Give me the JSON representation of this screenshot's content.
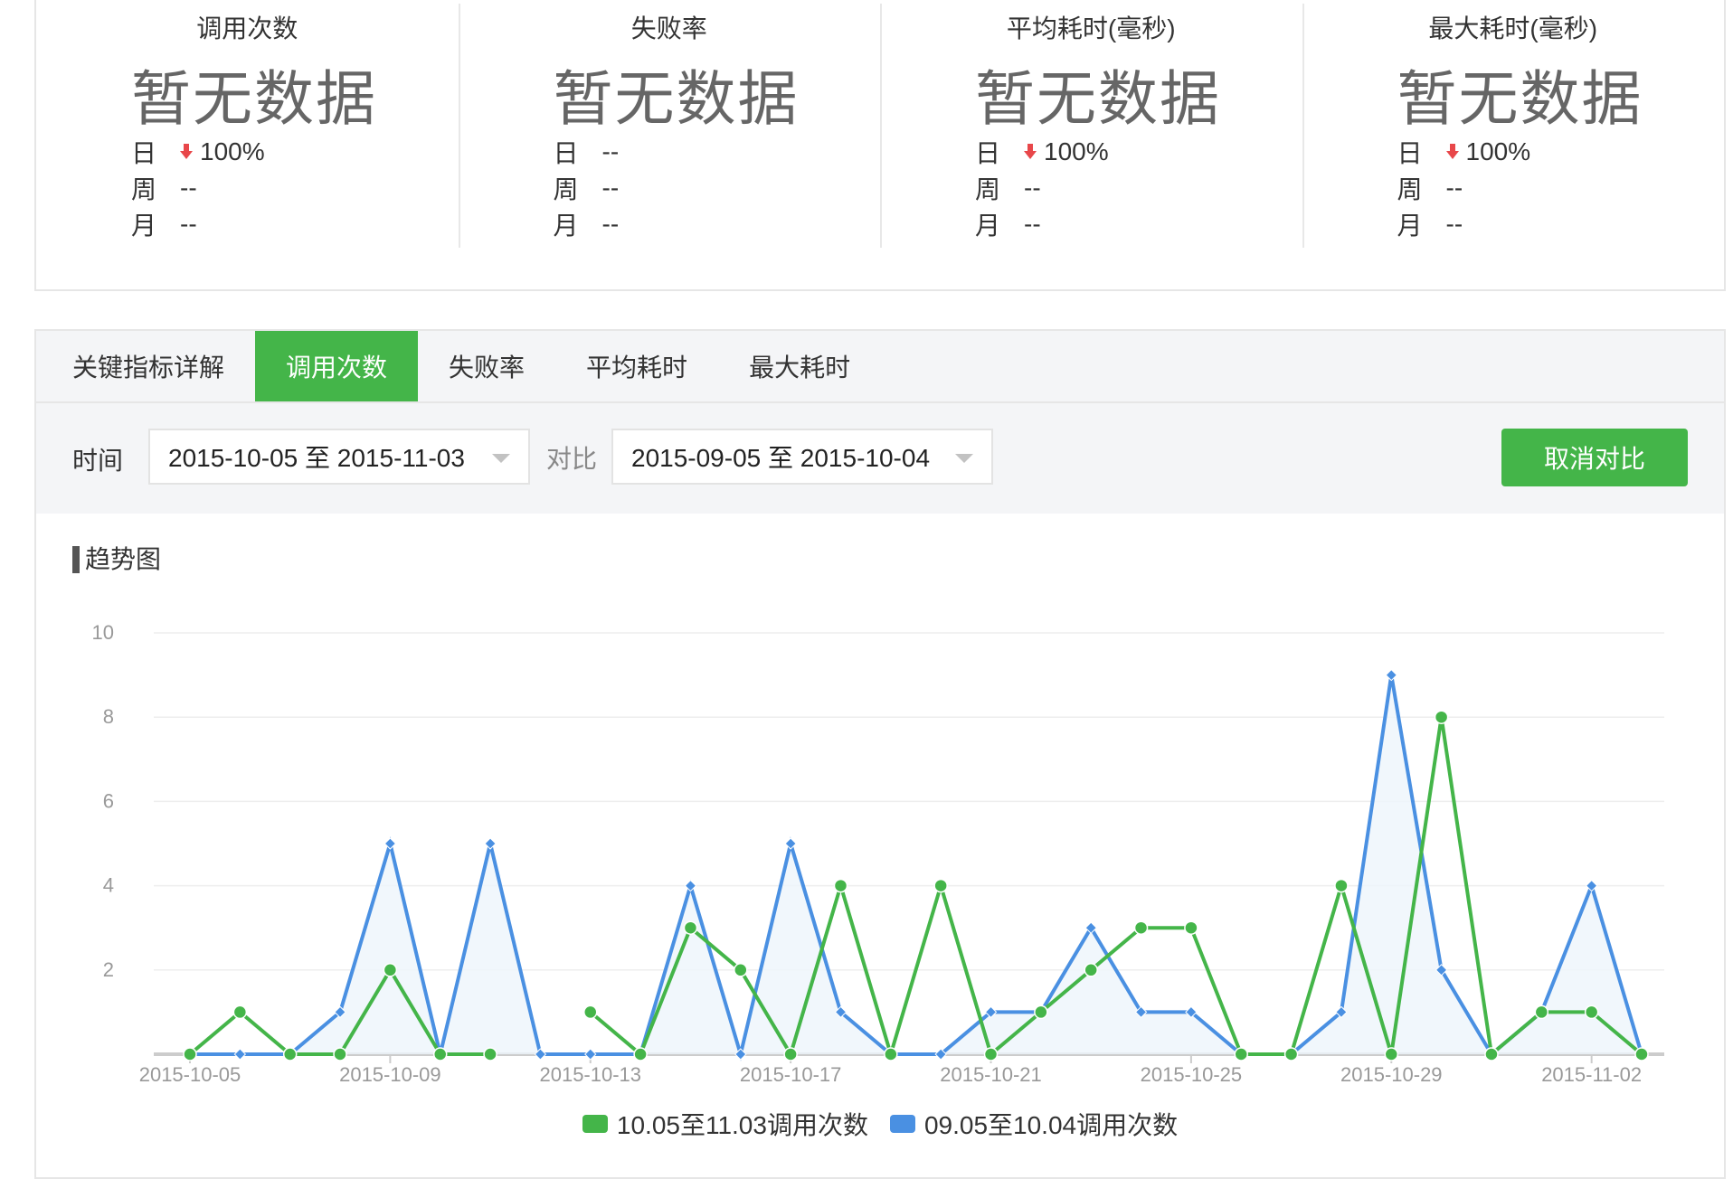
{
  "stats": [
    {
      "title": "调用次数",
      "value": "暂无数据",
      "rows": [
        {
          "label": "日",
          "value": "100%",
          "trend": "down"
        },
        {
          "label": "周",
          "value": "--",
          "trend": ""
        },
        {
          "label": "月",
          "value": "--",
          "trend": ""
        }
      ]
    },
    {
      "title": "失败率",
      "value": "暂无数据",
      "rows": [
        {
          "label": "日",
          "value": "--",
          "trend": ""
        },
        {
          "label": "周",
          "value": "--",
          "trend": ""
        },
        {
          "label": "月",
          "value": "--",
          "trend": ""
        }
      ]
    },
    {
      "title": "平均耗时(毫秒)",
      "value": "暂无数据",
      "rows": [
        {
          "label": "日",
          "value": "100%",
          "trend": "down"
        },
        {
          "label": "周",
          "value": "--",
          "trend": ""
        },
        {
          "label": "月",
          "value": "--",
          "trend": ""
        }
      ]
    },
    {
      "title": "最大耗时(毫秒)",
      "value": "暂无数据",
      "rows": [
        {
          "label": "日",
          "value": "100%",
          "trend": "down"
        },
        {
          "label": "周",
          "value": "--",
          "trend": ""
        },
        {
          "label": "月",
          "value": "--",
          "trend": ""
        }
      ]
    }
  ],
  "tabs": {
    "t0": "关键指标详解",
    "t1": "调用次数",
    "t2": "失败率",
    "t3": "平均耗时",
    "t4": "最大耗时"
  },
  "filters": {
    "time_label": "时间",
    "time_value": "2015-10-05 至 2015-11-03",
    "compare_label": "对比",
    "compare_value": "2015-09-05 至 2015-10-04",
    "cancel_label": "取消对比"
  },
  "section_title": "趋势图",
  "colors": {
    "green": "#44b549",
    "blue": "#4a90e2",
    "grid": "#eeeeee",
    "axis": "#cccccc"
  },
  "chart_data": {
    "type": "line",
    "ylim": [
      0,
      10
    ],
    "yticks": [
      "2",
      "4",
      "6",
      "8",
      "10"
    ],
    "x": [
      "2015-10-05",
      "2015-10-06",
      "2015-10-07",
      "2015-10-08",
      "2015-10-09",
      "2015-10-10",
      "2015-10-11",
      "2015-10-12",
      "2015-10-13",
      "2015-10-14",
      "2015-10-15",
      "2015-10-16",
      "2015-10-17",
      "2015-10-18",
      "2015-10-19",
      "2015-10-20",
      "2015-10-21",
      "2015-10-22",
      "2015-10-23",
      "2015-10-24",
      "2015-10-25",
      "2015-10-26",
      "2015-10-27",
      "2015-10-28",
      "2015-10-29",
      "2015-10-30",
      "2015-10-31",
      "2015-11-01",
      "2015-11-02",
      "2015-11-03"
    ],
    "xtick_labels": [
      "2015-10-05",
      "2015-10-09",
      "2015-10-13",
      "2015-10-17",
      "2015-10-21",
      "2015-10-25",
      "2015-10-29",
      "2015-11-02"
    ],
    "series": [
      {
        "name": "10.05至11.03调用次数",
        "color": "#44b549",
        "values": [
          0,
          1,
          0,
          0,
          2,
          0,
          0,
          null,
          1,
          0,
          3,
          2,
          0,
          4,
          0,
          4,
          0,
          1,
          2,
          3,
          3,
          0,
          0,
          4,
          0,
          8,
          0,
          1,
          1,
          0
        ]
      },
      {
        "name": "09.05至10.04调用次数",
        "color": "#4a90e2",
        "values": [
          0,
          0,
          0,
          1,
          5,
          0,
          5,
          0,
          0,
          0,
          4,
          0,
          5,
          1,
          0,
          0,
          1,
          1,
          3,
          1,
          1,
          0,
          0,
          1,
          9,
          2,
          0,
          1,
          4,
          0
        ]
      }
    ]
  }
}
